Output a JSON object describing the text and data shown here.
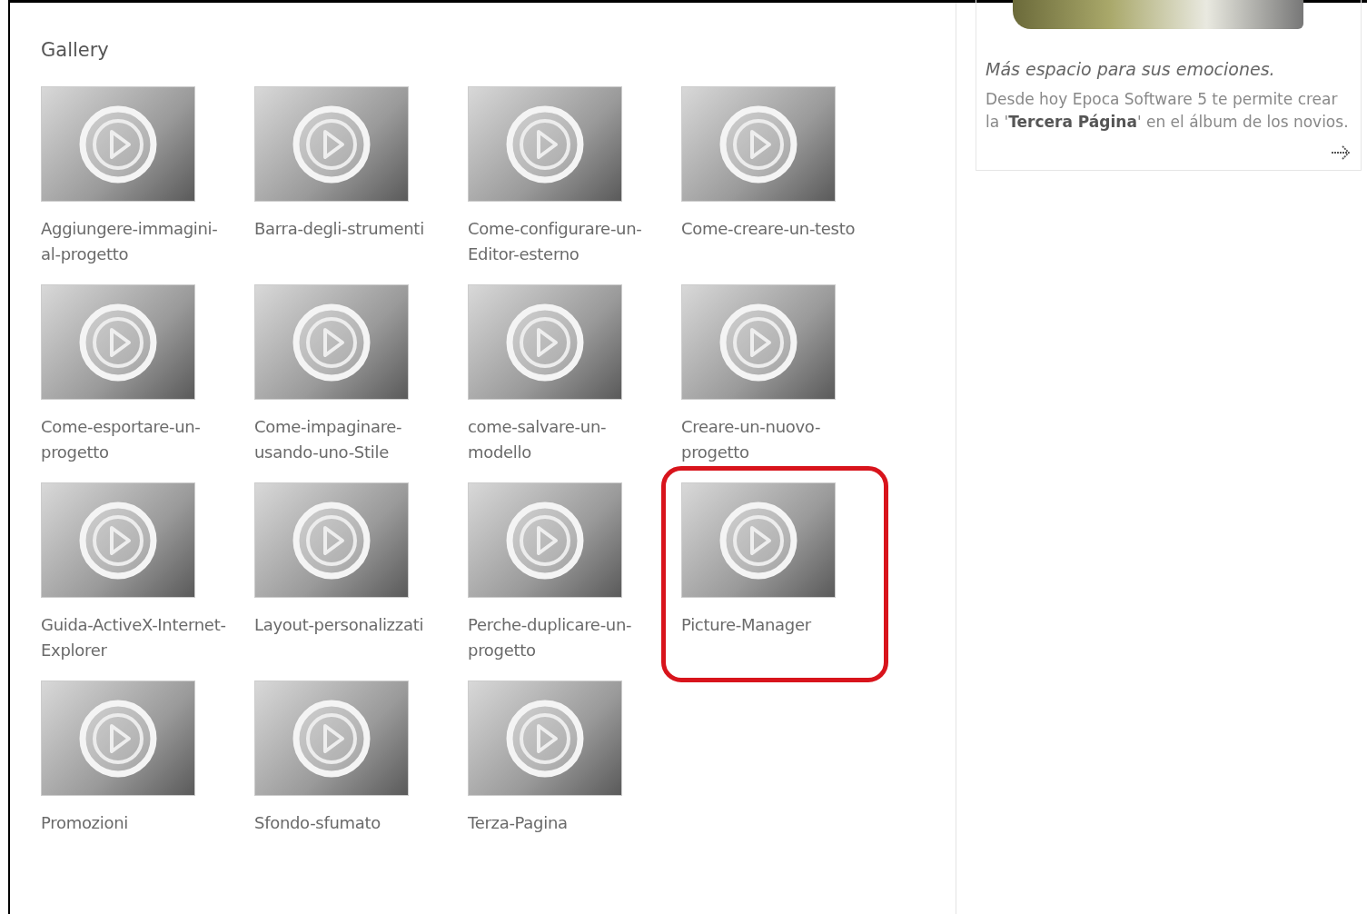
{
  "gallery": {
    "title": "Gallery",
    "items": [
      {
        "label": "Aggiungere-immagini-al-progetto",
        "highlighted": false
      },
      {
        "label": "Barra-degli-strumenti",
        "highlighted": false
      },
      {
        "label": "Come-configurare-un-Editor-esterno",
        "highlighted": false
      },
      {
        "label": "Come-creare-un-testo",
        "highlighted": false
      },
      {
        "label": "Come-esportare-un-progetto",
        "highlighted": false
      },
      {
        "label": "Come-impaginare-usando-uno-Stile",
        "highlighted": false
      },
      {
        "label": "come-salvare-un-modello",
        "highlighted": false
      },
      {
        "label": "Creare-un-nuovo-progetto",
        "highlighted": false
      },
      {
        "label": "Guida-ActiveX-Internet-Explorer",
        "highlighted": false
      },
      {
        "label": "Layout-personalizzati",
        "highlighted": false
      },
      {
        "label": "Perche-duplicare-un-progetto",
        "highlighted": false
      },
      {
        "label": "Picture-Manager",
        "highlighted": true
      },
      {
        "label": "Promozioni",
        "highlighted": false
      },
      {
        "label": "Sfondo-sfumato",
        "highlighted": false
      },
      {
        "label": "Terza-Pagina",
        "highlighted": false
      }
    ]
  },
  "promo": {
    "headline": "Más espacio para sus emociones.",
    "body": "Desde hoy Epoca Software 5 te permite crear la '**Tercera Página**' en el álbum de los novios."
  }
}
